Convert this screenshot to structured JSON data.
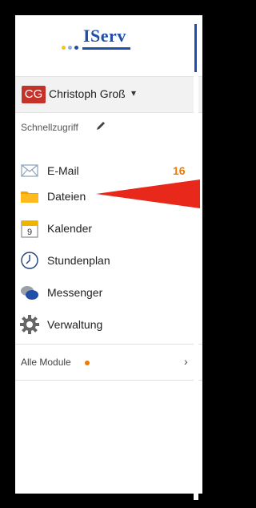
{
  "brand": {
    "logo_text": "IServ",
    "accent": "#1f4fa6",
    "dots": [
      "#f5c518",
      "#8ab3e0",
      "#1f4fa6"
    ]
  },
  "user": {
    "initials": "CG",
    "name": "Christoph Groß",
    "avatar_color": "#c4332a",
    "caret": "▾"
  },
  "quick_access": {
    "label": "Schnellzugriff",
    "edit_icon": "pencil-icon"
  },
  "nav": {
    "items": [
      {
        "label": "E-Mail",
        "icon": "envelope-icon",
        "count": "16"
      },
      {
        "label": "Dateien",
        "icon": "folder-icon",
        "count": ""
      },
      {
        "label": "Kalender",
        "icon": "calendar-icon",
        "count": "",
        "icon_text": "9"
      },
      {
        "label": "Stundenplan",
        "icon": "clock-icon",
        "count": ""
      },
      {
        "label": "Messenger",
        "icon": "chat-icon",
        "count": ""
      },
      {
        "label": "Verwaltung",
        "icon": "gear-icon",
        "count": ""
      }
    ]
  },
  "modules": {
    "label": "Alle Module",
    "dot_color": "#f07a00",
    "chevron": "›"
  },
  "annotation": {
    "icon": "red-arrow-pointer",
    "color": "#e8281b"
  }
}
